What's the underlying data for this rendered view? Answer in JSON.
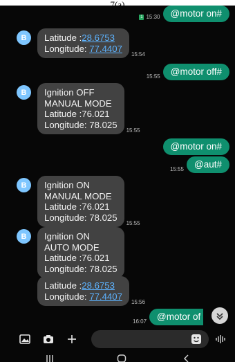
{
  "caption": "7(a)",
  "messages": [
    {
      "kind": "out",
      "sim_badge": "1",
      "time": "15:30",
      "text": "@motor on#"
    },
    {
      "kind": "in",
      "avatar": "B",
      "lines": [
        "Latitude :",
        "28.6753",
        "Longitude: ",
        "77.4407"
      ],
      "time": "15:54"
    },
    {
      "kind": "out",
      "time": "15:55",
      "text": "@motor off#"
    },
    {
      "kind": "in",
      "avatar": "B",
      "lines": [
        "Ignition OFF",
        "MANUAL MODE",
        "Latitude :76.021",
        "Longitude: 78.025"
      ],
      "time": "15:55"
    },
    {
      "kind": "out",
      "text": "@motor on#"
    },
    {
      "kind": "out",
      "time": "15:55",
      "text": "@aut#"
    },
    {
      "kind": "in",
      "avatar": "B",
      "lines": [
        "Ignition ON",
        "MANUAL MODE",
        "Latitude :76.021",
        "Longitude: 78.025"
      ],
      "time": "15:55"
    },
    {
      "kind": "in",
      "avatar": "B",
      "lines": [
        "Ignition ON",
        "AUTO MODE",
        "Latitude :76.021",
        "Longitude: 78.025"
      ]
    },
    {
      "kind": "in",
      "lines": [
        "Latitude :",
        "28.6753",
        "Longitude: ",
        "77.4407"
      ],
      "time": "15:56"
    },
    {
      "kind": "out",
      "time": "16:07",
      "text": "@motor of"
    }
  ],
  "composer": {
    "icons": [
      "gallery-icon",
      "camera-icon",
      "plus-icon",
      "sticker-icon",
      "voice-icon"
    ]
  },
  "navbar": {
    "icons": [
      "recents-icon",
      "home-icon",
      "back-icon"
    ]
  },
  "colors": {
    "outgoing_bubble": "#0f8f6e",
    "incoming_bubble": "#424242",
    "avatar": "#7ec6ff",
    "link": "#5db3ff"
  }
}
